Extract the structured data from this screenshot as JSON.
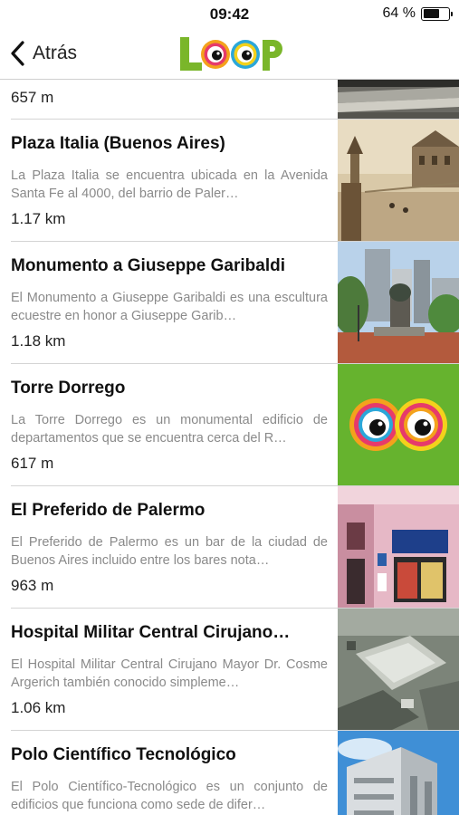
{
  "status_bar": {
    "time": "09:42",
    "battery": "64 %",
    "battery_level": 0.64
  },
  "nav": {
    "back_label": "Atrás",
    "logo": "LOOP"
  },
  "list": {
    "partial_item": {
      "distance": "657 m",
      "image": "street-photo"
    },
    "items": [
      {
        "title": "Plaza Italia (Buenos Aires)",
        "description": "La Plaza Italia se encuentra ubicada en la Avenida Santa Fe al 4000, del barrio de Paler…",
        "distance": "1.17 km",
        "image": "sepia-plaza-photo"
      },
      {
        "title": "Monumento a Giuseppe Garibaldi",
        "description": "El Monumento a Giuseppe Garibaldi es una escultura ecuestre en honor a Giuseppe Garib…",
        "distance": "1.18 km",
        "image": "monument-photo"
      },
      {
        "title": "Torre Dorrego",
        "description": "La Torre Dorrego es un monumental edificio de departamentos que se encuentra cerca del R…",
        "distance": "617 m",
        "image": "loop-eyes-placeholder"
      },
      {
        "title": "El Preferido de Palermo",
        "description": "El Preferido de Palermo es un bar de la ciudad de Buenos Aires incluido entre los bares nota…",
        "distance": "963 m",
        "image": "pink-building-photo"
      },
      {
        "title": "Hospital Militar Central Cirujano…",
        "description": "El Hospital Militar Central Cirujano Mayor Dr. Cosme Argerich también conocido simpleme…",
        "distance": "1.06 km",
        "image": "aerial-hospital-photo"
      },
      {
        "title": "Polo Científico Tecnológico",
        "description": "El Polo Científico-Tecnológico es un conjunto de edificios que funciona como sede de difer…",
        "distance": "",
        "image": "modern-building-photo"
      }
    ]
  },
  "colors": {
    "logo_green": "#7ab62a",
    "placeholder_green": "#66b32e",
    "divider": "#d4d4d4",
    "description_gray": "#8a8a8a"
  }
}
